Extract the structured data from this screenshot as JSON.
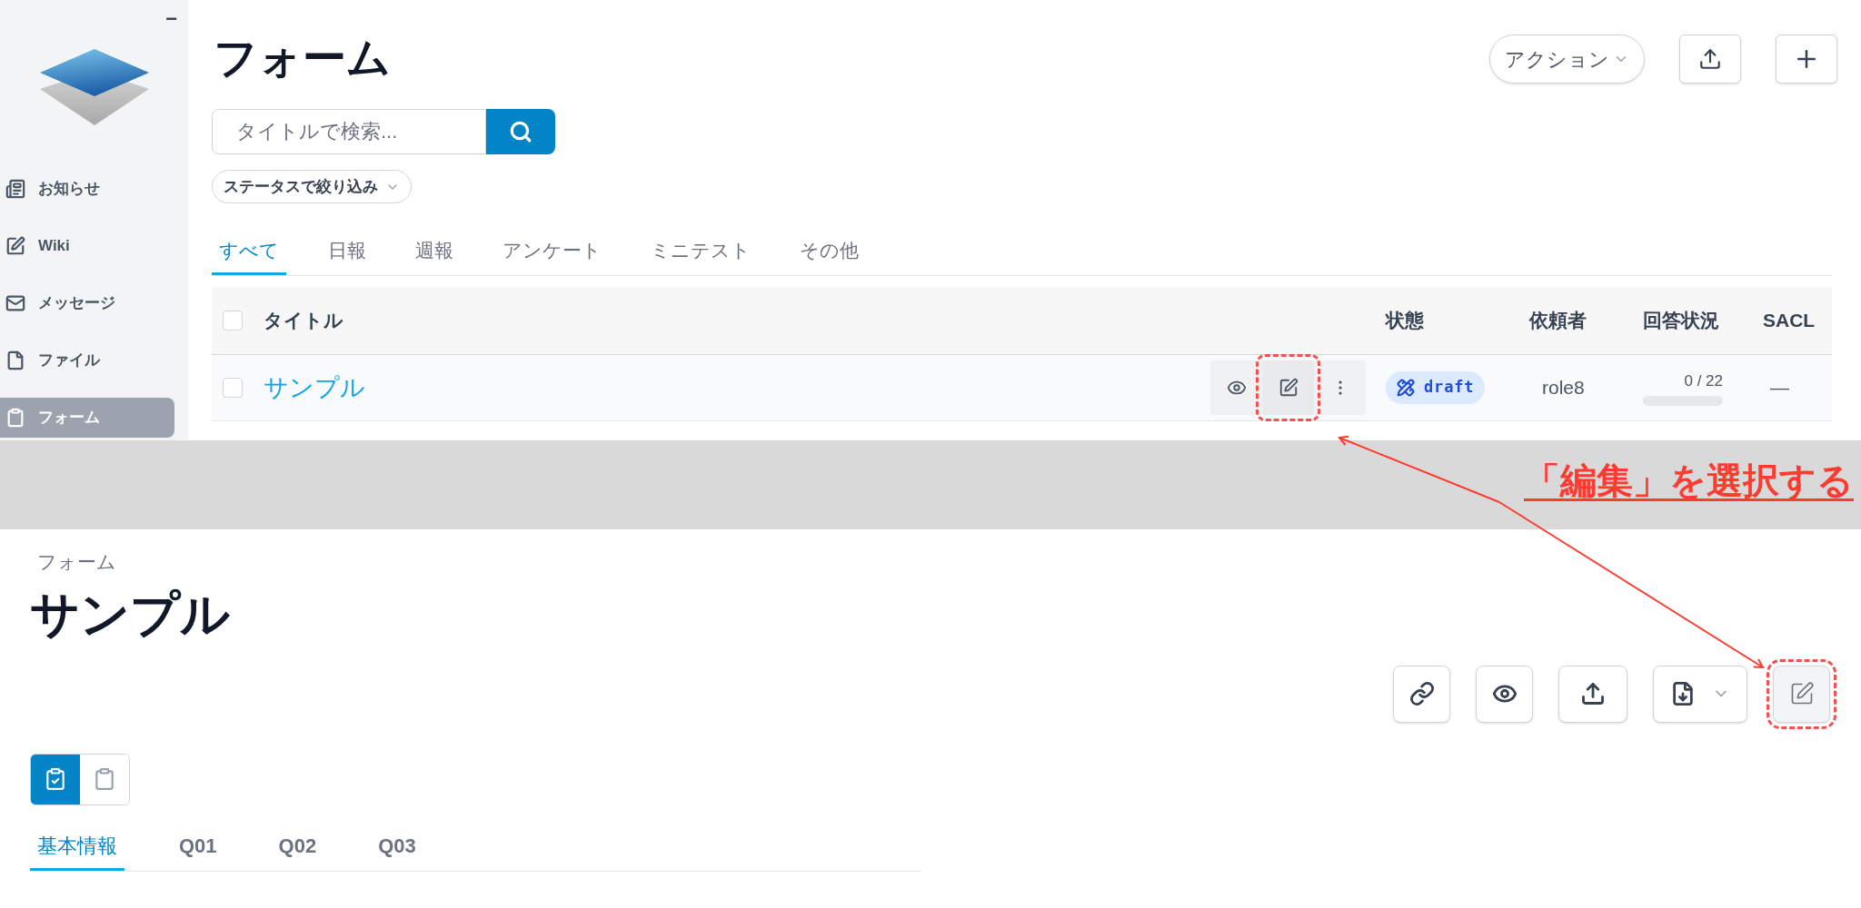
{
  "sidebar": {
    "minimize": "−",
    "items": [
      {
        "label": "お知らせ",
        "kind": "news",
        "selected": false
      },
      {
        "label": "Wiki",
        "kind": "edit",
        "selected": false
      },
      {
        "label": "メッセージ",
        "kind": "mail",
        "selected": false
      },
      {
        "label": "ファイル",
        "kind": "file",
        "selected": false
      },
      {
        "label": "フォーム",
        "kind": "form",
        "selected": true
      }
    ]
  },
  "page_title": "フォーム",
  "header_actions": [
    {
      "kind": "dropdown",
      "label": "アクション"
    },
    {
      "kind": "upload"
    },
    {
      "kind": "add"
    }
  ],
  "search": {
    "placeholder": "タイトルで検索..."
  },
  "filter": {
    "label": "ステータスで絞り込み"
  },
  "tabs": [
    {
      "label": "すべて",
      "selected": true
    },
    {
      "label": "日報",
      "selected": false
    },
    {
      "label": "週報",
      "selected": false
    },
    {
      "label": "アンケート",
      "selected": false
    },
    {
      "label": "ミニテスト",
      "selected": false
    },
    {
      "label": "その他",
      "selected": false
    }
  ],
  "table": {
    "header_checked": false,
    "columns": [
      "タイトル",
      "状態",
      "依頼者",
      "回答状況",
      "SACL"
    ],
    "rows": [
      {
        "checked": false,
        "title": "サンプル",
        "actions": [
          {
            "kind": "view",
            "highlighted": false
          },
          {
            "kind": "edit",
            "highlighted": true
          },
          {
            "kind": "more",
            "highlighted": false
          }
        ],
        "status": "draft",
        "requester": "role8",
        "progress": "0 / 22",
        "level": 0,
        "sacl": "—"
      }
    ]
  },
  "annotation": {
    "text": "「編集」を選択する"
  },
  "detail": {
    "breadcrumb": "フォーム",
    "title": "サンプル",
    "toolbar": [
      {
        "kind": "link",
        "highlighted": false
      },
      {
        "kind": "view",
        "highlighted": false
      },
      {
        "kind": "upload",
        "highlighted": false
      },
      {
        "kind": "download",
        "highlighted": false
      },
      {
        "kind": "edit",
        "highlighted": true
      }
    ],
    "view_toggle": [
      {
        "kind": "checked-clipboard",
        "selected": true
      },
      {
        "kind": "clipboard",
        "selected": false
      }
    ],
    "tabs": [
      {
        "label": "基本情報",
        "selected": true
      },
      {
        "label": "Q01",
        "selected": false
      },
      {
        "label": "Q02",
        "selected": false
      },
      {
        "label": "Q03",
        "selected": false
      }
    ]
  }
}
